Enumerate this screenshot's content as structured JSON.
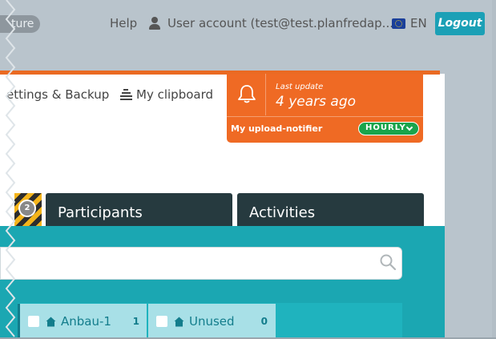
{
  "topbar": {
    "truncated_pill": "ture",
    "help": "Help",
    "user_account": "User account (test@test.planfredap...",
    "language": "EN",
    "logout": "Logout"
  },
  "nav": {
    "settings_backup": "ettings & Backup",
    "my_clipboard": "My clipboard"
  },
  "notifier": {
    "last_update_label": "Last update",
    "last_update_value": "4 years ago",
    "upload_notifier_label": "My upload-notifier",
    "frequency": "HOURLY"
  },
  "tabs": {
    "badge_count": "2",
    "items": [
      {
        "label": "Participants"
      },
      {
        "label": "Activities"
      }
    ]
  },
  "filters": {
    "chips": [
      {
        "label": "Anbau-1",
        "count": "1"
      },
      {
        "label": "Unused",
        "count": "0"
      }
    ]
  },
  "colors": {
    "accent_teal": "#1ba7b2",
    "notifier_orange": "#ef6a24",
    "logout_blue": "#1ba0b6",
    "frequency_green": "#19a44c",
    "tab_dark": "#263a3f"
  },
  "icons": [
    "user-icon",
    "flag-eu-icon",
    "clipboard-icon",
    "bell-icon",
    "chevron-down-icon",
    "search-icon",
    "house-icon"
  ]
}
